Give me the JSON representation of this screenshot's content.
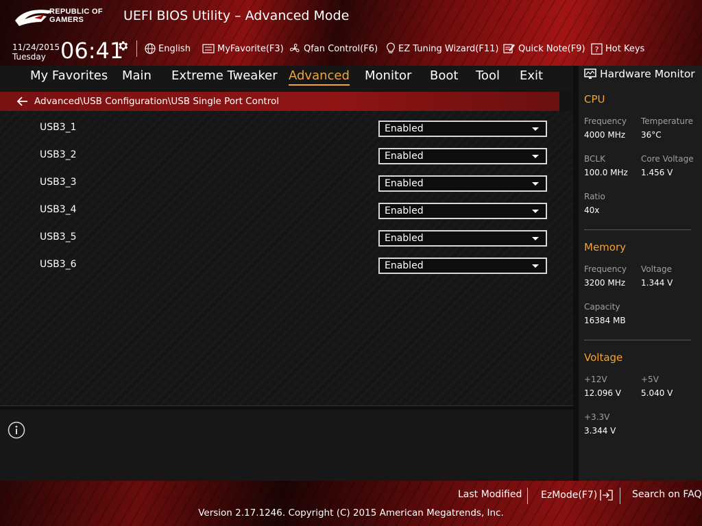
{
  "header": {
    "brand_line1": "REPUBLIC OF",
    "brand_line2": "GAMERS",
    "title": "UEFI BIOS Utility – Advanced Mode",
    "date": "11/24/2015",
    "day": "Tuesday",
    "time": "06:41"
  },
  "toolbar": {
    "language": "English",
    "my_favorite": "MyFavorite(F3)",
    "qfan": "Qfan Control(F6)",
    "ez_tuning": "EZ Tuning Wizard(F11)",
    "quick_note": "Quick Note(F9)",
    "hot_keys": "Hot Keys"
  },
  "tabs": [
    "My Favorites",
    "Main",
    "Extreme Tweaker",
    "Advanced",
    "Monitor",
    "Boot",
    "Tool",
    "Exit"
  ],
  "active_tab": "Advanced",
  "breadcrumb": "Advanced\\USB Configuration\\USB Single Port Control",
  "settings": [
    {
      "label": "USB3_1",
      "value": "Enabled"
    },
    {
      "label": "USB3_2",
      "value": "Enabled"
    },
    {
      "label": "USB3_3",
      "value": "Enabled"
    },
    {
      "label": "USB3_4",
      "value": "Enabled"
    },
    {
      "label": "USB3_5",
      "value": "Enabled"
    },
    {
      "label": "USB3_6",
      "value": "Enabled"
    }
  ],
  "hw_monitor": {
    "title": "Hardware Monitor",
    "cpu": {
      "heading": "CPU",
      "frequency_label": "Frequency",
      "frequency": "4000 MHz",
      "temperature_label": "Temperature",
      "temperature": "36°C",
      "bclk_label": "BCLK",
      "bclk": "100.0 MHz",
      "core_voltage_label": "Core Voltage",
      "core_voltage": "1.456 V",
      "ratio_label": "Ratio",
      "ratio": "40x"
    },
    "memory": {
      "heading": "Memory",
      "frequency_label": "Frequency",
      "frequency": "3200 MHz",
      "voltage_label": "Voltage",
      "voltage": "1.344 V",
      "capacity_label": "Capacity",
      "capacity": "16384 MB"
    },
    "voltage": {
      "heading": "Voltage",
      "v12_label": "+12V",
      "v12": "12.096 V",
      "v5_label": "+5V",
      "v5": "5.040 V",
      "v33_label": "+3.3V",
      "v33": "3.344 V"
    }
  },
  "footer": {
    "last_modified": "Last Modified",
    "ez_mode": "EzMode(F7)",
    "search_faq": "Search on FAQ",
    "copyright": "Version 2.17.1246. Copyright (C) 2015 American Megatrends, Inc."
  },
  "colors": {
    "accent": "#f2a33a",
    "breadcrumb_bg": "#8e1414",
    "panel_bg": "#1c1c1c"
  }
}
